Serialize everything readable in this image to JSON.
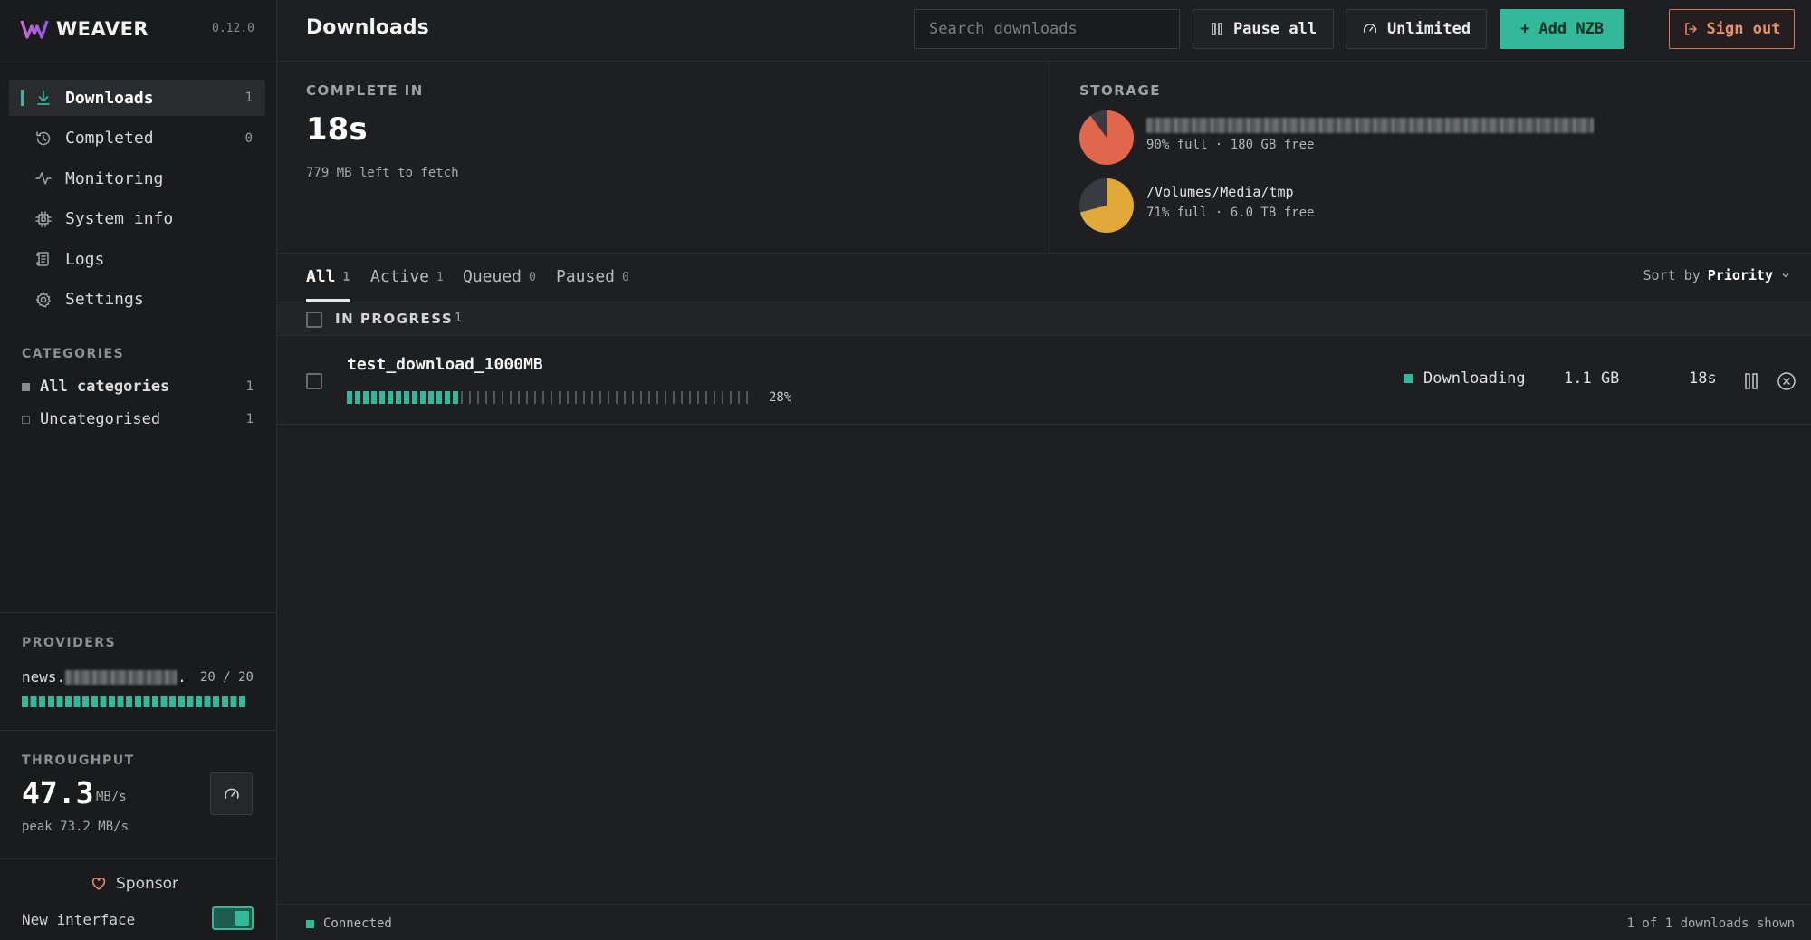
{
  "app": {
    "name": "WEAVER",
    "version": "0.12.0",
    "accent_color": "#33b89a"
  },
  "sidebar": {
    "nav": [
      {
        "label": "Downloads",
        "count": "1",
        "icon": "download-icon",
        "active": true
      },
      {
        "label": "Completed",
        "count": "0",
        "icon": "history-icon"
      },
      {
        "label": "Monitoring",
        "count": "",
        "icon": "activity-icon"
      },
      {
        "label": "System info",
        "count": "",
        "icon": "cpu-chip-icon"
      },
      {
        "label": "Logs",
        "count": "",
        "icon": "scroll-icon"
      },
      {
        "label": "Settings",
        "count": "",
        "icon": "gear-icon"
      }
    ],
    "categories_label": "CATEGORIES",
    "categories": [
      {
        "label": "All categories",
        "count": "1"
      },
      {
        "label": "Uncategorised",
        "count": "1"
      }
    ],
    "providers_label": "PROVIDERS",
    "provider": {
      "name_prefix": "news.",
      "name_suffix": ".",
      "connections": "20 / 20",
      "usage_fraction": 1.0
    },
    "throughput_label": "THROUGHPUT",
    "throughput": {
      "value": "47.3",
      "unit": "MB/s",
      "peak": "peak 73.2 MB/s"
    },
    "sponsor_label": "Sponsor",
    "new_interface_label": "New interface",
    "new_interface_enabled": true
  },
  "header": {
    "title": "Downloads",
    "search_placeholder": "Search downloads",
    "pause_all_label": "Pause all",
    "speed_limit_label": "Unlimited",
    "add_nzb_label": "+ Add NZB",
    "sign_out_label": "Sign out"
  },
  "stats": {
    "complete_label": "COMPLETE IN",
    "complete_value": "18s",
    "left_to_fetch": "779 MB left to fetch",
    "storage_label": "STORAGE",
    "storage": [
      {
        "path": "",
        "meta": "90% full · 180 GB free",
        "fill_fraction": 0.9,
        "color": "#e0674e"
      },
      {
        "path": "/Volumes/Media/tmp",
        "meta": "71% full · 6.0 TB free",
        "fill_fraction": 0.71,
        "color": "#e0a93a"
      }
    ]
  },
  "tabs": [
    {
      "label": "All",
      "count": "1",
      "active": true
    },
    {
      "label": "Active",
      "count": "1"
    },
    {
      "label": "Queued",
      "count": "0"
    },
    {
      "label": "Paused",
      "count": "0"
    }
  ],
  "sort": {
    "prefix": "Sort by",
    "value": "Priority"
  },
  "group": {
    "label": "IN PROGRESS",
    "count": "1"
  },
  "downloads": [
    {
      "name": "test_download_1000MB",
      "progress_fraction": 0.28,
      "progress_text": "28%",
      "status": "Downloading",
      "size": "1.1 GB",
      "eta": "18s"
    }
  ],
  "footer": {
    "connection": "Connected",
    "shown": "1 of 1 downloads shown"
  }
}
